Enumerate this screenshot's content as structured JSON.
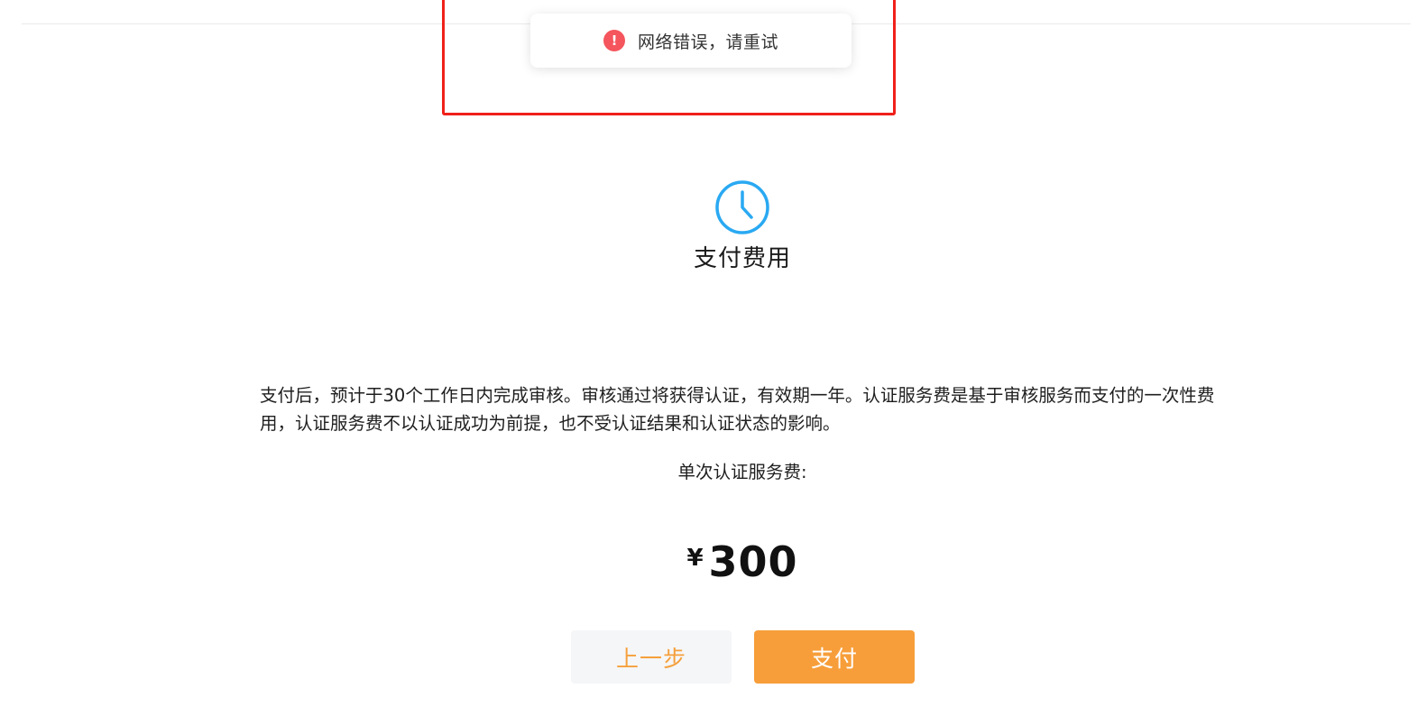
{
  "toast": {
    "icon": "exclamation-circle-icon",
    "icon_glyph": "!",
    "message": "网络错误，请重试",
    "color": "#f5555d"
  },
  "step": {
    "icon": "clock-icon",
    "title": "支付费用",
    "accent_color": "#29a9f2"
  },
  "description": "支付后，预计于30个工作日内完成审核。审核通过将获得认证，有效期一年。认证服务费是基于审核服务而支付的一次性费用，认证服务费不以认证成功为前提，也不受认证结果和认证状态的影响。",
  "fee": {
    "label": "单次认证服务费:",
    "currency": "¥",
    "amount": "300"
  },
  "buttons": {
    "prev_label": "上一步",
    "pay_label": "支付",
    "accent_color": "#f79e3a"
  }
}
